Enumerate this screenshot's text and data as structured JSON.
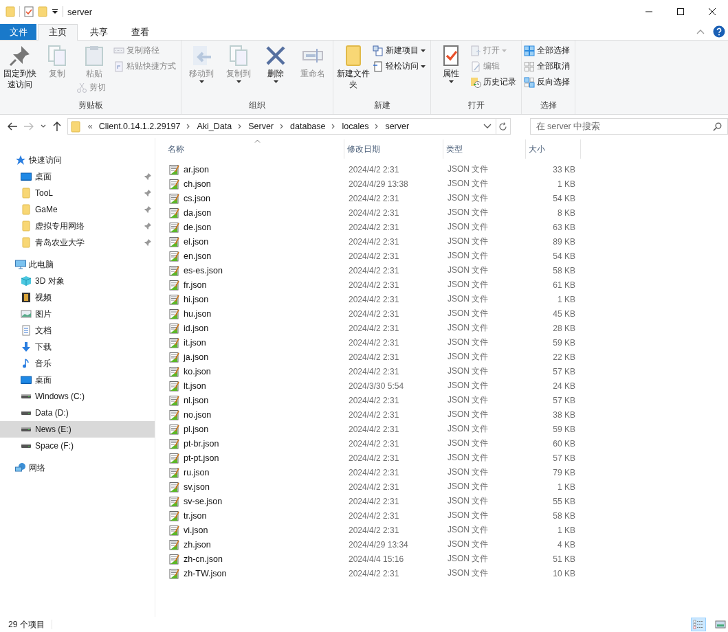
{
  "window": {
    "title": "server"
  },
  "ribbon_tabs": [
    {
      "label": "文件",
      "kind": "file",
      "selected": false
    },
    {
      "label": "主页",
      "kind": "tab",
      "selected": true
    },
    {
      "label": "共享",
      "kind": "tab",
      "selected": false
    },
    {
      "label": "查看",
      "kind": "tab",
      "selected": false
    }
  ],
  "ribbon_groups": [
    {
      "label": "剪贴板",
      "columns": [
        [
          {
            "label": "固定到快速访问",
            "kind": "large",
            "disabled": false,
            "dropdown": false
          }
        ],
        [
          {
            "label": "复制",
            "kind": "large",
            "disabled": true,
            "dropdown": false
          }
        ],
        [
          {
            "label": "粘贴",
            "kind": "large",
            "disabled": true,
            "dropdown": false
          },
          {
            "label": "剪切",
            "kind": "small",
            "disabled": true,
            "dropdown": false
          }
        ],
        [
          {
            "label": "复制路径",
            "kind": "small",
            "disabled": true,
            "dropdown": false
          },
          {
            "label": "粘贴快捷方式",
            "kind": "small",
            "disabled": true,
            "dropdown": false
          }
        ]
      ]
    },
    {
      "label": "组织",
      "columns": [
        [
          {
            "label": "移动到",
            "kind": "large",
            "disabled": true,
            "dropdown": true
          }
        ],
        [
          {
            "label": "复制到",
            "kind": "large",
            "disabled": true,
            "dropdown": true
          }
        ],
        [
          {
            "label": "删除",
            "kind": "large",
            "disabled": false,
            "dropdown": true
          }
        ],
        [
          {
            "label": "重命名",
            "kind": "large",
            "disabled": true,
            "dropdown": false
          }
        ]
      ]
    },
    {
      "label": "新建",
      "columns": [
        [
          {
            "label": "新建文件夹",
            "kind": "large",
            "disabled": false,
            "dropdown": false
          }
        ],
        [
          {
            "label": "新建项目",
            "kind": "small",
            "disabled": false,
            "dropdown": true
          },
          {
            "label": "轻松访问",
            "kind": "small",
            "disabled": false,
            "dropdown": true
          }
        ]
      ]
    },
    {
      "label": "打开",
      "columns": [
        [
          {
            "label": "属性",
            "kind": "large",
            "disabled": false,
            "dropdown": true
          }
        ],
        [
          {
            "label": "打开",
            "kind": "small",
            "disabled": true,
            "dropdown": true
          },
          {
            "label": "编辑",
            "kind": "small",
            "disabled": true,
            "dropdown": false
          },
          {
            "label": "历史记录",
            "kind": "small",
            "disabled": false,
            "dropdown": false
          }
        ]
      ]
    },
    {
      "label": "选择",
      "columns": [
        [
          {
            "label": "全部选择",
            "kind": "small",
            "disabled": false,
            "dropdown": false
          },
          {
            "label": "全部取消",
            "kind": "small",
            "disabled": false,
            "dropdown": false
          },
          {
            "label": "反向选择",
            "kind": "small",
            "disabled": false,
            "dropdown": false
          }
        ]
      ]
    }
  ],
  "address_bar": {
    "overflow": "«",
    "segments": [
      "Client.0.14.1.2.29197",
      "Aki_Data",
      "Server",
      "database",
      "locales",
      "server"
    ]
  },
  "search": {
    "placeholder": "在 server 中搜索"
  },
  "navigation": [
    {
      "label": "快速访问",
      "children": [
        {
          "label": "桌面",
          "pinned": true,
          "selected": false
        },
        {
          "label": "TooL",
          "pinned": true,
          "selected": false
        },
        {
          "label": "GaMe",
          "pinned": true,
          "selected": false
        },
        {
          "label": "虚拟专用网络",
          "pinned": true,
          "selected": false
        },
        {
          "label": "青岛农业大学",
          "pinned": true,
          "selected": false
        }
      ]
    },
    {
      "label": "此电脑",
      "children": [
        {
          "label": "3D 对象",
          "pinned": false,
          "selected": false
        },
        {
          "label": "视频",
          "pinned": false,
          "selected": false
        },
        {
          "label": "图片",
          "pinned": false,
          "selected": false
        },
        {
          "label": "文档",
          "pinned": false,
          "selected": false
        },
        {
          "label": "下载",
          "pinned": false,
          "selected": false
        },
        {
          "label": "音乐",
          "pinned": false,
          "selected": false
        },
        {
          "label": "桌面",
          "pinned": false,
          "selected": false
        },
        {
          "label": "Windows (C:)",
          "pinned": false,
          "selected": false
        },
        {
          "label": "Data (D:)",
          "pinned": false,
          "selected": false
        },
        {
          "label": "News (E:)",
          "pinned": false,
          "selected": true
        },
        {
          "label": "Space (F:)",
          "pinned": false,
          "selected": false
        }
      ]
    },
    {
      "label": "网络"
    }
  ],
  "table": {
    "columns": [
      {
        "label": "名称",
        "sorted": true
      },
      {
        "label": "修改日期",
        "sorted": false
      },
      {
        "label": "类型",
        "sorted": false
      },
      {
        "label": "大小",
        "sorted": false
      }
    ],
    "rows": [
      [
        "ar.json",
        "2024/4/2 2:31",
        "JSON 文件",
        "33 KB"
      ],
      [
        "ch.json",
        "2024/4/29 13:38",
        "JSON 文件",
        "1 KB"
      ],
      [
        "cs.json",
        "2024/4/2 2:31",
        "JSON 文件",
        "54 KB"
      ],
      [
        "da.json",
        "2024/4/2 2:31",
        "JSON 文件",
        "8 KB"
      ],
      [
        "de.json",
        "2024/4/2 2:31",
        "JSON 文件",
        "63 KB"
      ],
      [
        "el.json",
        "2024/4/2 2:31",
        "JSON 文件",
        "89 KB"
      ],
      [
        "en.json",
        "2024/4/2 2:31",
        "JSON 文件",
        "54 KB"
      ],
      [
        "es-es.json",
        "2024/4/2 2:31",
        "JSON 文件",
        "58 KB"
      ],
      [
        "fr.json",
        "2024/4/2 2:31",
        "JSON 文件",
        "61 KB"
      ],
      [
        "hi.json",
        "2024/4/2 2:31",
        "JSON 文件",
        "1 KB"
      ],
      [
        "hu.json",
        "2024/4/2 2:31",
        "JSON 文件",
        "45 KB"
      ],
      [
        "id.json",
        "2024/4/2 2:31",
        "JSON 文件",
        "28 KB"
      ],
      [
        "it.json",
        "2024/4/2 2:31",
        "JSON 文件",
        "59 KB"
      ],
      [
        "ja.json",
        "2024/4/2 2:31",
        "JSON 文件",
        "22 KB"
      ],
      [
        "ko.json",
        "2024/4/2 2:31",
        "JSON 文件",
        "57 KB"
      ],
      [
        "lt.json",
        "2024/3/30 5:54",
        "JSON 文件",
        "24 KB"
      ],
      [
        "nl.json",
        "2024/4/2 2:31",
        "JSON 文件",
        "57 KB"
      ],
      [
        "no.json",
        "2024/4/2 2:31",
        "JSON 文件",
        "38 KB"
      ],
      [
        "pl.json",
        "2024/4/2 2:31",
        "JSON 文件",
        "59 KB"
      ],
      [
        "pt-br.json",
        "2024/4/2 2:31",
        "JSON 文件",
        "60 KB"
      ],
      [
        "pt-pt.json",
        "2024/4/2 2:31",
        "JSON 文件",
        "57 KB"
      ],
      [
        "ru.json",
        "2024/4/2 2:31",
        "JSON 文件",
        "79 KB"
      ],
      [
        "sv.json",
        "2024/4/2 2:31",
        "JSON 文件",
        "1 KB"
      ],
      [
        "sv-se.json",
        "2024/4/2 2:31",
        "JSON 文件",
        "55 KB"
      ],
      [
        "tr.json",
        "2024/4/2 2:31",
        "JSON 文件",
        "58 KB"
      ],
      [
        "vi.json",
        "2024/4/2 2:31",
        "JSON 文件",
        "1 KB"
      ],
      [
        "zh.json",
        "2024/4/29 13:34",
        "JSON 文件",
        "4 KB"
      ],
      [
        "zh-cn.json",
        "2024/4/4 15:16",
        "JSON 文件",
        "51 KB"
      ],
      [
        "zh-TW.json",
        "2024/4/2 2:31",
        "JSON 文件",
        "10 KB"
      ]
    ]
  },
  "status_bar": {
    "item_count": "29 个项目",
    "views": [
      {
        "kind": "details",
        "selected": true
      },
      {
        "kind": "large-icons",
        "selected": false
      }
    ]
  }
}
